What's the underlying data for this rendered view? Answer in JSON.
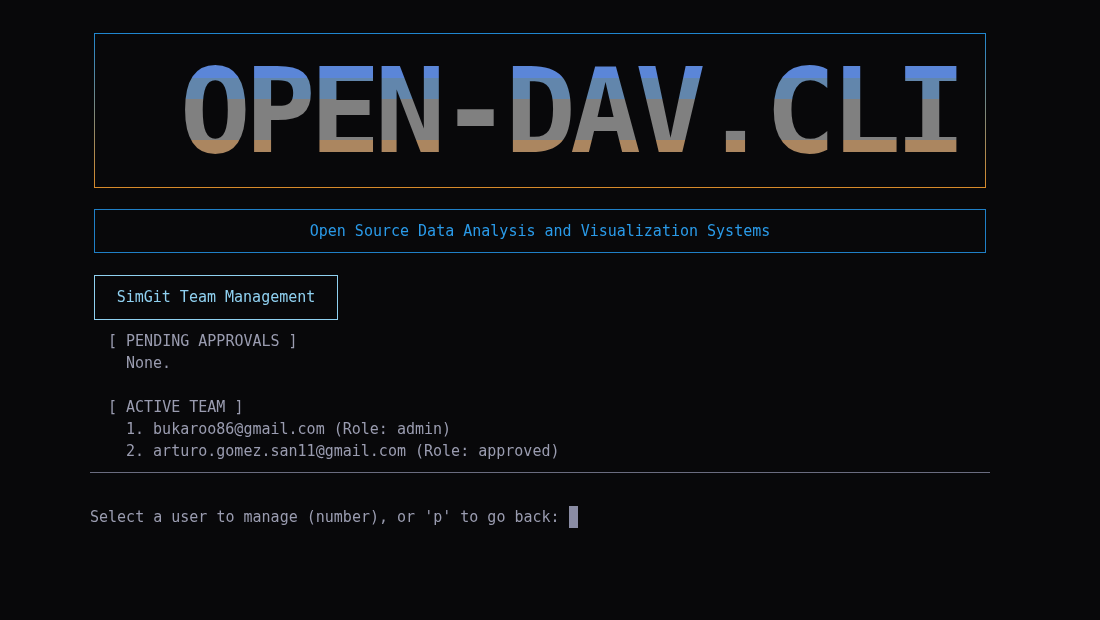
{
  "banner": {
    "logo": "OPEN-DAV.CLI",
    "subtitle": "Open Source Data Analysis and Visualization Systems"
  },
  "header": {
    "title": "SimGit Team Management"
  },
  "sections": [
    {
      "heading": "[ PENDING APPROVALS ]",
      "lines": [
        "None."
      ]
    },
    {
      "heading": "[ ACTIVE TEAM ]",
      "lines": [
        "1. bukaroo86@gmail.com (Role: admin)",
        "2. arturo.gomez.san11@gmail.com (Role: approved)"
      ]
    }
  ],
  "prompt": {
    "text": "Select a user to manage (number), or 'p' to go back:"
  }
}
